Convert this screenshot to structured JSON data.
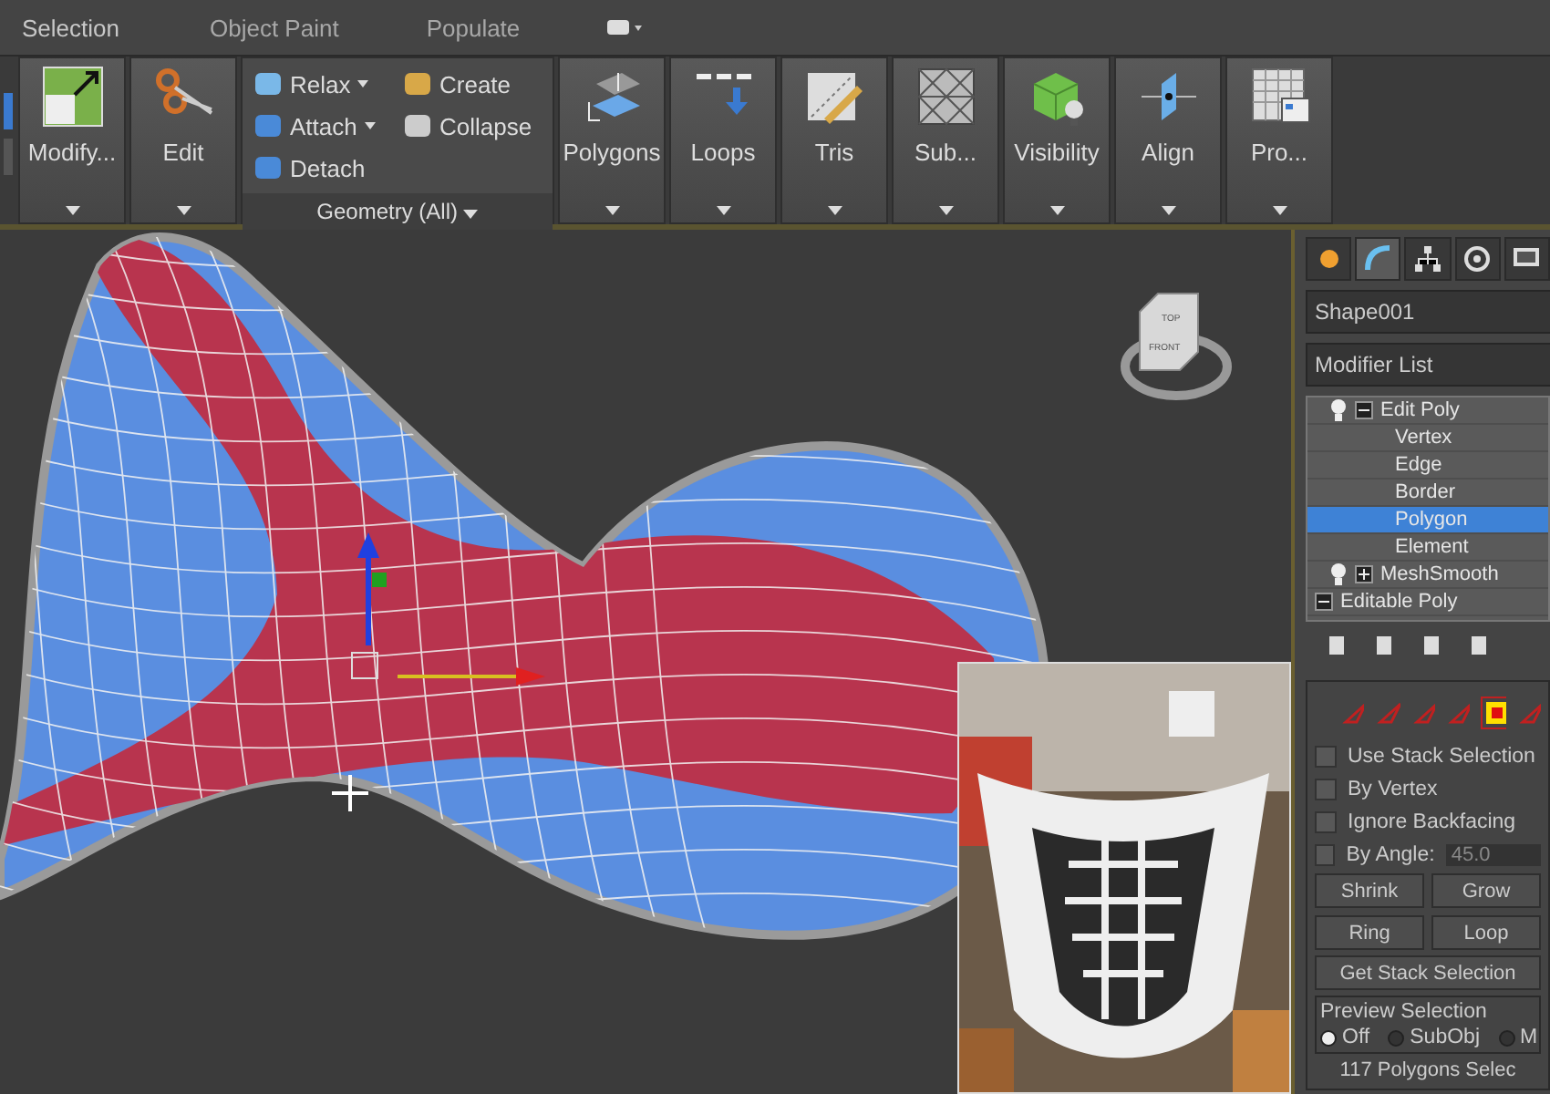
{
  "ribbon_tabs": [
    {
      "label": "Selection",
      "selected": true
    },
    {
      "label": "Object Paint",
      "selected": false
    },
    {
      "label": "Populate",
      "selected": false
    }
  ],
  "ribbon_large_left": [
    {
      "label": "Modify..."
    },
    {
      "label": "Edit"
    }
  ],
  "geometry_group": {
    "title": "Geometry (All)",
    "items": [
      {
        "label": "Relax",
        "dropdown": true
      },
      {
        "label": "Create",
        "dropdown": false
      },
      {
        "label": "Attach",
        "dropdown": true
      },
      {
        "label": "Collapse",
        "dropdown": false
      },
      {
        "label": "Detach",
        "dropdown": false
      }
    ]
  },
  "ribbon_large_right": [
    {
      "label": "Polygons"
    },
    {
      "label": "Loops"
    },
    {
      "label": "Tris"
    },
    {
      "label": "Sub..."
    },
    {
      "label": "Visibility"
    },
    {
      "label": "Align"
    },
    {
      "label": "Pro..."
    }
  ],
  "viewcube": {
    "top": "TOP",
    "front": "FRONT"
  },
  "command_panel": {
    "tabs": [
      {
        "selected": false
      },
      {
        "selected": true
      },
      {
        "selected": false
      },
      {
        "selected": false
      },
      {
        "selected": false
      }
    ],
    "object_name": "Shape001",
    "modifier_list": "Modifier List",
    "stack": [
      {
        "kind": "modifier",
        "label": "Edit Poly",
        "expanded": true,
        "selected": false
      },
      {
        "kind": "sub",
        "label": "Vertex",
        "selected": false
      },
      {
        "kind": "sub",
        "label": "Edge",
        "selected": false
      },
      {
        "kind": "sub",
        "label": "Border",
        "selected": false
      },
      {
        "kind": "sub",
        "label": "Polygon",
        "selected": true
      },
      {
        "kind": "sub",
        "label": "Element",
        "selected": false
      },
      {
        "kind": "modifier",
        "label": "MeshSmooth",
        "expanded": false,
        "selected": false
      },
      {
        "kind": "base",
        "label": "Editable Poly",
        "expanded": true,
        "selected": false
      }
    ],
    "subobject_levels": [
      {
        "selected": false
      },
      {
        "selected": false
      },
      {
        "selected": false
      },
      {
        "selected": false
      },
      {
        "selected": true
      },
      {
        "selected": false
      }
    ],
    "checkboxes": [
      {
        "label": "Use Stack Selection",
        "checked": false
      },
      {
        "label": "By Vertex",
        "checked": false
      },
      {
        "label": "Ignore Backfacing",
        "checked": false
      },
      {
        "label": "By Angle:",
        "checked": false,
        "value": "45.0"
      }
    ],
    "buttons": [
      {
        "label": "Shrink"
      },
      {
        "label": "Grow"
      },
      {
        "label": "Ring"
      },
      {
        "label": "Loop"
      }
    ],
    "get_stack_selection": "Get Stack Selection",
    "preview_selection": {
      "title": "Preview Selection",
      "options": [
        {
          "label": "Off",
          "selected": true
        },
        {
          "label": "SubObj",
          "selected": false
        },
        {
          "label": "M",
          "selected": false
        }
      ]
    },
    "status": "117 Polygons Selec"
  }
}
